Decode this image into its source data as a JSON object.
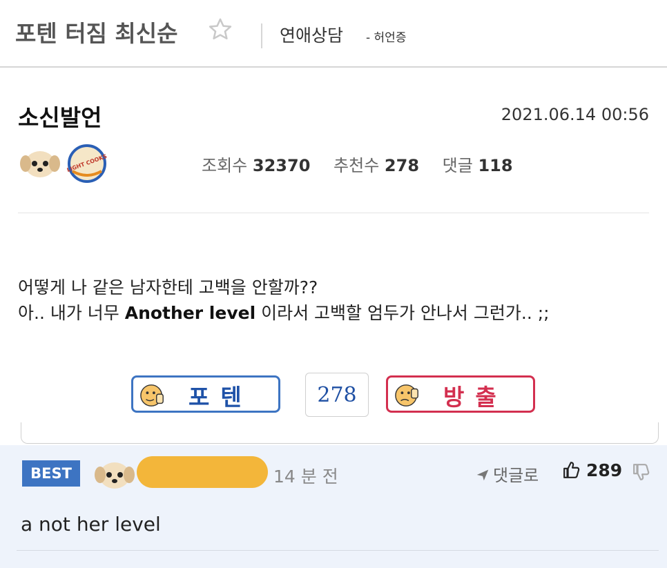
{
  "header": {
    "board_title": "포텐 터짐 최신순",
    "category": "연애상담",
    "sub_category": "- 허언증"
  },
  "post": {
    "title": "소신발언",
    "date": "2021.06.14 00:56",
    "stats": {
      "views_label": "조회수",
      "views": "32370",
      "recommend_label": "추천수",
      "recommend": "278",
      "comments_label": "댓글",
      "comments": "118"
    },
    "body": {
      "line1": "어떻게 나 같은 남자한테 고백을 안할까??",
      "line2_pre": "아.. 내가 너무 ",
      "line2_bold": "Another level",
      "line2_post": " 이라서 고백할 엄두가 안나서 그런가.. ;;"
    },
    "badge_text": "LIGHT COOKS"
  },
  "vote": {
    "up_label": "포텐",
    "count": "278",
    "down_label": "방출",
    "up_color": "#3d74c2",
    "down_color": "#d32f4f"
  },
  "comment": {
    "badge": "BEST",
    "time": "14 분 전",
    "reply_label": "댓글로",
    "likes": "289",
    "text": "a not her level",
    "redaction_color": "#f3b63a"
  }
}
